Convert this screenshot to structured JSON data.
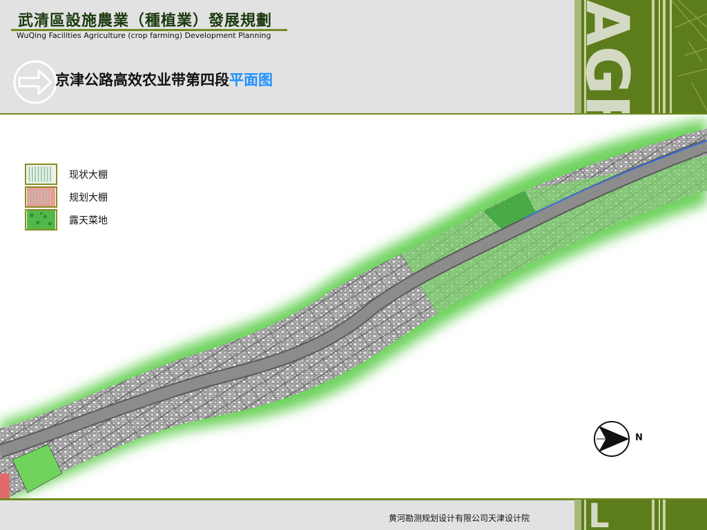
{
  "header": {
    "title_cn": "武清區設施農業（種植業）發展規劃",
    "title_en": "WuQing Facilities Agriculture (crop farming) Development Planning",
    "brand_letters": "AGR",
    "page_title_main": "京津公路高效农业带第四段",
    "page_title_highlight": "平面图",
    "highlight_color": "#1e90ff",
    "accent_color": "#6f8a1e"
  },
  "legend": {
    "items": [
      {
        "label": "现状大棚",
        "swatch": "existing-greenhouse"
      },
      {
        "label": "规划大棚",
        "swatch": "planned-greenhouse"
      },
      {
        "label": "露天菜地",
        "swatch": "open-field"
      }
    ]
  },
  "map": {
    "compass_letter": "N",
    "road_color": "#8c8c8c",
    "vegetation_color": "#6fd35e"
  },
  "footer": {
    "organization": "黄河勘测规划设计有限公司天津设计院",
    "brand_letter": "L"
  }
}
